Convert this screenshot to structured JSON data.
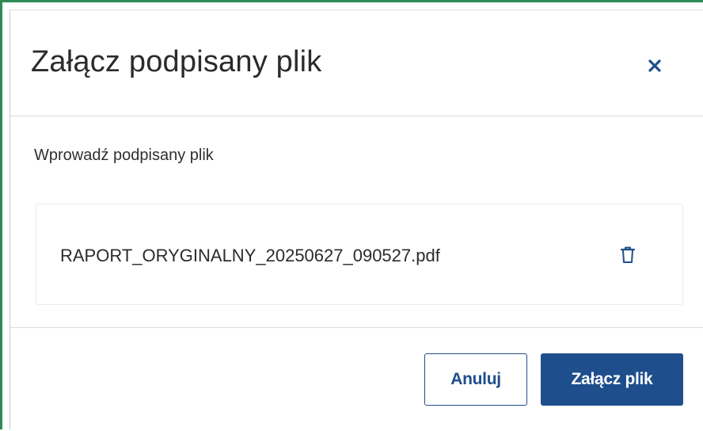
{
  "dialog": {
    "title": "Załącz podpisany plik",
    "close_icon": "close-icon",
    "label": "Wprowadź podpisany plik",
    "file": {
      "name": "RAPORT_ORYGINALNY_20250627_090527.pdf",
      "delete_icon": "trash-icon"
    },
    "buttons": {
      "cancel": "Anuluj",
      "submit": "Załącz plik"
    }
  },
  "colors": {
    "frame_border": "#2e8b57",
    "primary": "#1f4e8c",
    "text": "#2b2b2b"
  }
}
